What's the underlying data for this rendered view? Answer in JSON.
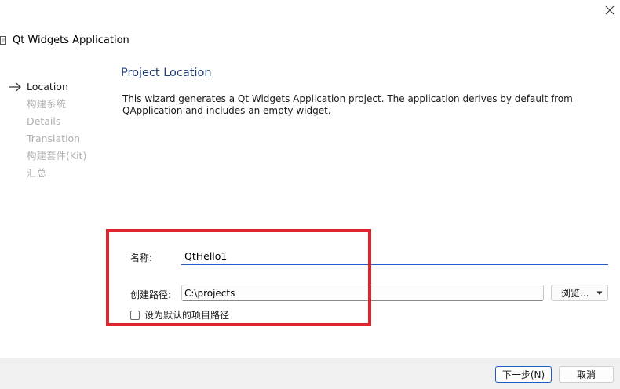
{
  "window": {
    "title": "Qt Widgets Application"
  },
  "steps": [
    {
      "label": "Location",
      "current": true
    },
    {
      "label": "构建系统",
      "current": false
    },
    {
      "label": "Details",
      "current": false
    },
    {
      "label": "Translation",
      "current": false
    },
    {
      "label": "构建套件(Kit)",
      "current": false
    },
    {
      "label": "汇总",
      "current": false
    }
  ],
  "page": {
    "title": "Project Location",
    "description": "This wizard generates a Qt Widgets Application project. The application derives by default from QApplication and includes an empty widget."
  },
  "form": {
    "name_label": "名称:",
    "name_value": "QtHello1",
    "path_label": "创建路径:",
    "path_value": "C:\\projects",
    "browse_label": "浏览...",
    "default_path_label": "设为默认的项目路径",
    "default_path_checked": false
  },
  "footer": {
    "next_label": "下一步(N)",
    "cancel_label": "取消"
  },
  "colors": {
    "accent": "#1e5bc6",
    "title_blue": "#1f3c7a",
    "highlight_red": "#e0242c",
    "disabled_text": "#b0b0b0"
  },
  "icons": {
    "close": "close-icon",
    "app": "app-icon",
    "current_step": "arrow-right-icon",
    "dropdown": "chevron-down-icon"
  }
}
